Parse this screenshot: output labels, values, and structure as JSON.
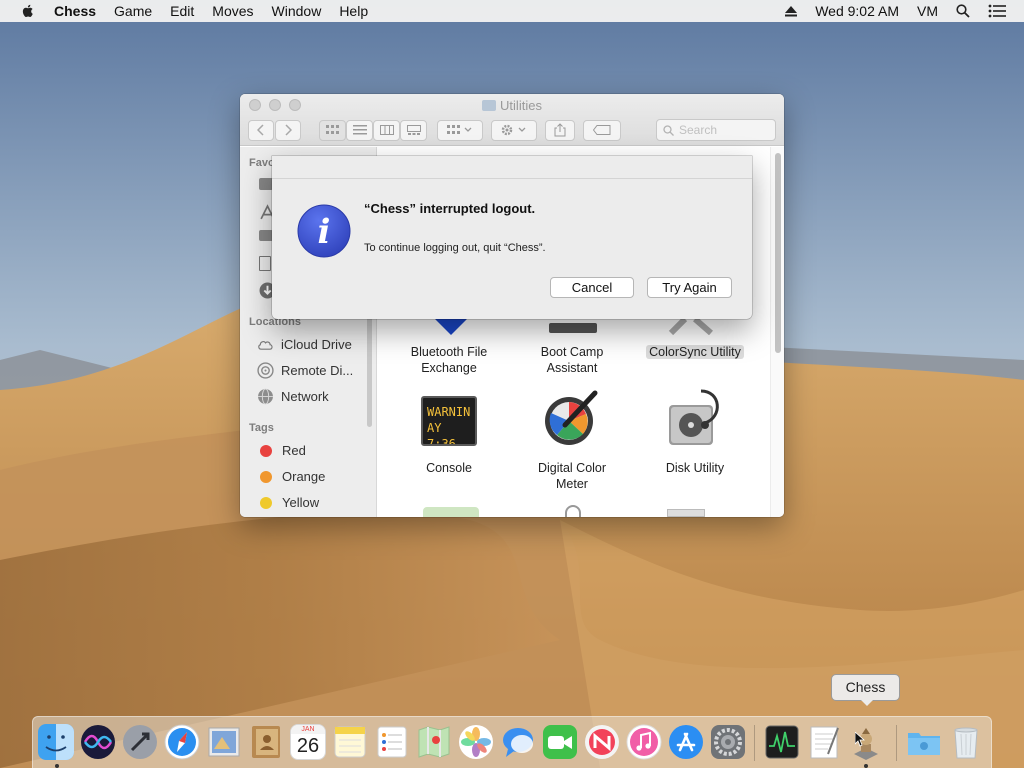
{
  "menubar": {
    "apple_icon": "apple-icon",
    "app_name": "Chess",
    "menus": [
      "Game",
      "Edit",
      "Moves",
      "Window",
      "Help"
    ],
    "clock": "Wed 9:02 AM",
    "user": "VM",
    "status_icons": [
      "eject-icon",
      "search-icon",
      "notification-center-icon"
    ]
  },
  "finder": {
    "title": "Utilities",
    "search_placeholder": "Search",
    "sidebar": {
      "favorites_label": "Favo",
      "locations_label": "Locations",
      "locations": [
        "iCloud Drive",
        "Remote Di...",
        "Network"
      ],
      "tags_label": "Tags",
      "tags": [
        {
          "name": "Red",
          "color": "#e8423f"
        },
        {
          "name": "Orange",
          "color": "#f0972e"
        },
        {
          "name": "Yellow",
          "color": "#efc92b"
        }
      ]
    },
    "apps": [
      {
        "line1": "Bluetooth File",
        "line2": "Exchange"
      },
      {
        "line1": "Boot Camp",
        "line2": "Assistant"
      },
      {
        "line1": "ColorSync Utility",
        "line2": ""
      },
      {
        "line1": "Console",
        "line2": ""
      },
      {
        "line1": "Digital Color",
        "line2": "Meter"
      },
      {
        "line1": "Disk Utility",
        "line2": ""
      }
    ],
    "console_icon_text": {
      "line1": "WARNIN",
      "line2": "AY 7:36"
    }
  },
  "alert": {
    "headline": "“Chess” interrupted logout.",
    "message": "To continue logging out, quit “Chess”.",
    "cancel_label": "Cancel",
    "try_again_label": "Try Again"
  },
  "dock": {
    "tooltip": "Chess",
    "calendar_month": "JAN",
    "calendar_day": "26"
  },
  "colors": {
    "info_blue": "#3a55d6",
    "alert_bg": "#ececec",
    "menubar_bg": "#f0f0f0"
  }
}
